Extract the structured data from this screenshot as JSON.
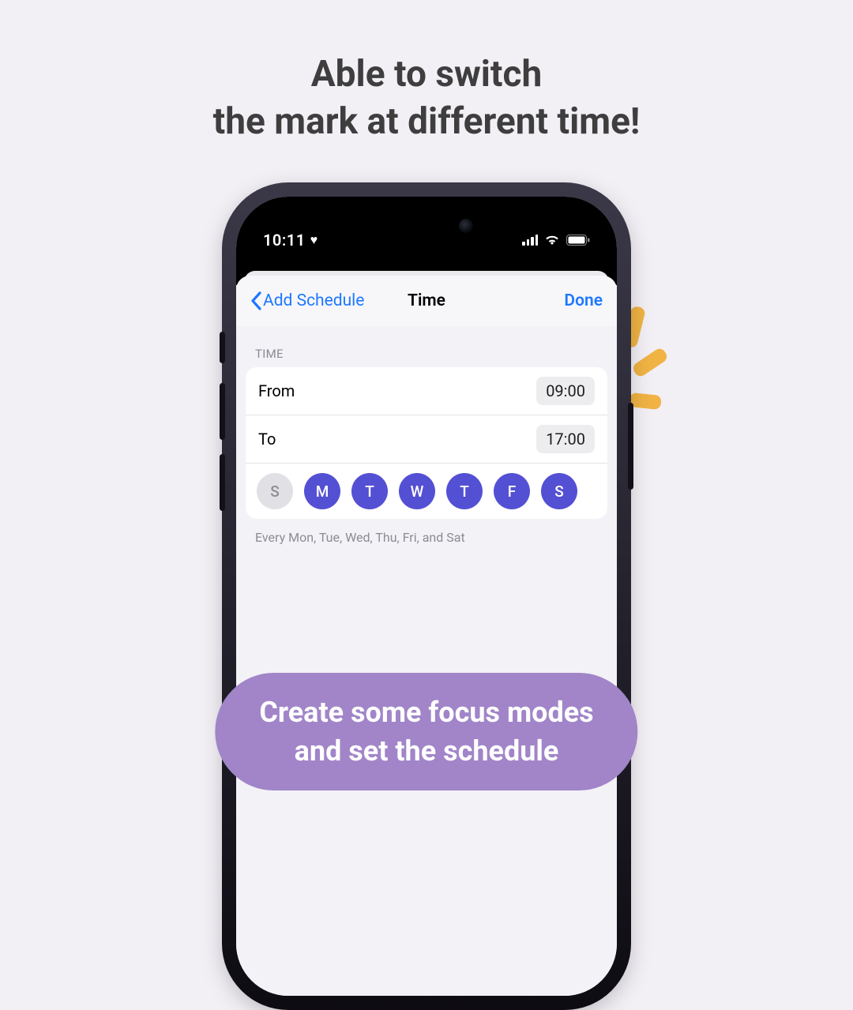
{
  "promo": {
    "headline_line1": "Able to switch",
    "headline_line2": "the mark at different time!",
    "caption_line1": "Create some focus modes",
    "caption_line2": "and set the schedule"
  },
  "status": {
    "time": "10:11"
  },
  "nav": {
    "back_label": "Add Schedule",
    "title": "Time",
    "done_label": "Done"
  },
  "section": {
    "time_header": "TIME",
    "from_label": "From",
    "from_value": "09:00",
    "to_label": "To",
    "to_value": "17:00"
  },
  "days": [
    {
      "letter": "S",
      "selected": false
    },
    {
      "letter": "M",
      "selected": true
    },
    {
      "letter": "T",
      "selected": true
    },
    {
      "letter": "W",
      "selected": true
    },
    {
      "letter": "T",
      "selected": true
    },
    {
      "letter": "F",
      "selected": true
    },
    {
      "letter": "S",
      "selected": true
    }
  ],
  "summary": "Every Mon, Tue, Wed, Thu, Fri, and Sat"
}
